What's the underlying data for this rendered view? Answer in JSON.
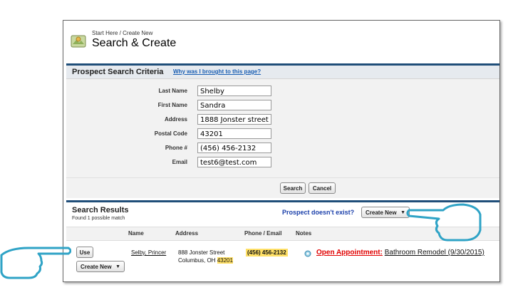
{
  "header": {
    "breadcrumb": "Start Here / Create New",
    "title": "Search & Create"
  },
  "criteria": {
    "title": "Prospect Search Criteria",
    "help_link": "Why was I brought to this page?",
    "fields": [
      {
        "label": "Last Name",
        "value": "Shelby"
      },
      {
        "label": "First Name",
        "value": "Sandra"
      },
      {
        "label": "Address",
        "value": "1888 Jonster street"
      },
      {
        "label": "Postal Code",
        "value": "43201"
      },
      {
        "label": "Phone #",
        "value": "(456) 456-2132"
      },
      {
        "label": "Email",
        "value": "test6@test.com"
      }
    ],
    "search_label": "Search",
    "cancel_label": "Cancel"
  },
  "results": {
    "title": "Search Results",
    "subtitle": "Found 1 possible match",
    "prospect_question": "Prospect doesn't exist?",
    "create_new_label": "Create New",
    "columns": [
      "Name",
      "Address",
      "Phone / Email",
      "Notes"
    ],
    "rows": [
      {
        "use_label": "Use",
        "create_new_label": "Create New",
        "name": "Selby, Princer",
        "address_line1": "888 Jonster Street",
        "city_state": "Columbus, OH",
        "zip": "43201",
        "phone": "(456) 456-2132",
        "note_link": "Open Appointment:",
        "note_text": "Bathroom Remodel (9/30/2015)"
      }
    ]
  },
  "colors": {
    "section_border": "#1f4e79",
    "link": "#1a5fb4",
    "highlight": "#ffe066",
    "annotation": "#2fa3c6",
    "appointment": "#e00000"
  },
  "icons": [
    "app-map-icon",
    "pointing-hand-icon",
    "dropdown-arrow-icon",
    "gear-icon"
  ]
}
